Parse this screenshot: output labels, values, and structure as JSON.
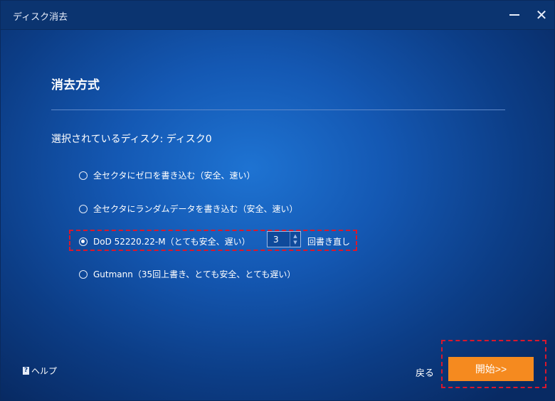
{
  "window": {
    "title": "ディスク消去"
  },
  "heading": "消去方式",
  "selected_disk_label": "選択されているディスク: ディスク0",
  "options": [
    {
      "label": "全セクタにゼロを書き込む（安全、速い）",
      "checked": false
    },
    {
      "label": "全セクタにランダムデータを書き込む（安全、速い）",
      "checked": false
    },
    {
      "label": "DoD 52220.22-M（とても安全、遅い）",
      "checked": true
    },
    {
      "label": "Gutmann（35回上書き、とても安全、とても遅い）",
      "checked": false
    }
  ],
  "stepper": {
    "value": "3",
    "suffix": "回書き直し"
  },
  "footer": {
    "help_label": "ヘルプ",
    "back_label": "戻る",
    "start_label": "開始>>"
  },
  "colors": {
    "accent": "#f58a1f",
    "highlight": "#d9182d",
    "background": "#1458b3"
  },
  "icons": {
    "minimize": "minimize-icon",
    "close": "close-icon",
    "help": "help-icon"
  }
}
